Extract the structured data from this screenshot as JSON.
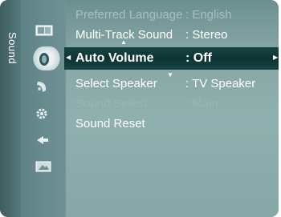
{
  "sidebar": {
    "title": "Sound"
  },
  "menu": {
    "items": [
      {
        "label": "Preferred Language",
        "value": ": English",
        "state": "dim"
      },
      {
        "label": "Multi-Track Sound",
        "value": ": Stereo",
        "state": "normal"
      },
      {
        "label": "Auto Volume",
        "value": ": Off",
        "state": "selected"
      },
      {
        "label": "Select Speaker",
        "value": ": TV Speaker",
        "state": "normal"
      },
      {
        "label": "Sound Select",
        "value": ": Main",
        "state": "dim"
      },
      {
        "label": "Sound Reset",
        "value": "",
        "state": "normal"
      }
    ]
  },
  "icons": [
    "picture-icon",
    "sound-icon",
    "channel-icon",
    "setup-icon",
    "input-icon",
    "application-icon"
  ],
  "colors": {
    "panel": "#4a6c70",
    "highlight": "#0d3432",
    "text": "#ffffff",
    "dim_text": "#a9c0c0"
  }
}
